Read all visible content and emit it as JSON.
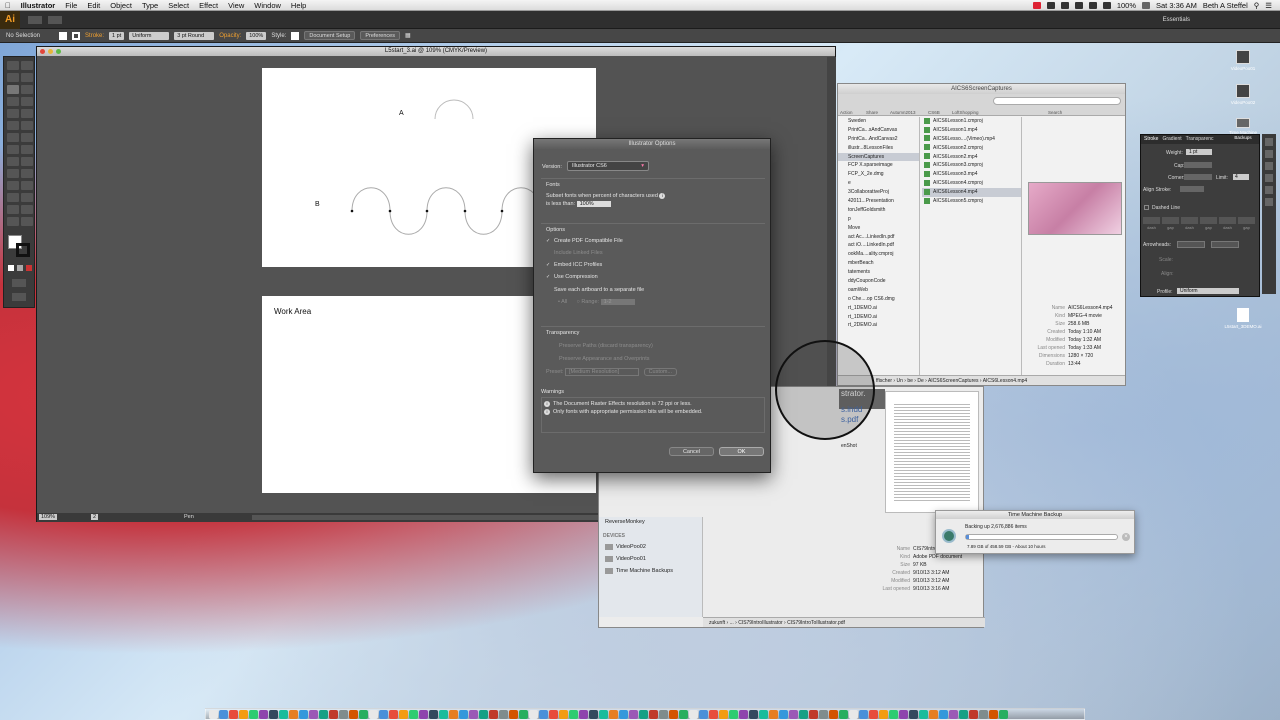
{
  "menubar": {
    "app": "Illustrator",
    "items": [
      "File",
      "Edit",
      "Object",
      "Type",
      "Select",
      "Effect",
      "View",
      "Window",
      "Help"
    ],
    "battery": "100%",
    "clock": "Sat 3:36 AM",
    "user": "Beth A Steffel"
  },
  "topbar": {
    "logo": "Ai",
    "workspace": "Essentials"
  },
  "control": {
    "selection": "No Selection",
    "stroke_label": "Stroke:",
    "stroke_value": "1 pt",
    "profile": "Uniform",
    "brush": "3 pt Round",
    "opacity_label": "Opacity:",
    "opacity_value": "100%",
    "style_label": "Style:",
    "doc_setup": "Document Setup",
    "preferences": "Preferences"
  },
  "document": {
    "title": "L5start_3.ai @ 109% (CMYK/Preview)",
    "label_a": "A",
    "label_b": "B",
    "work_area": "Work Area",
    "zoom": "109%",
    "page": "2",
    "tool_status": "Pen"
  },
  "dialog": {
    "title": "Illustrator Options",
    "version_label": "Version:",
    "version_value": "Illustrator CS6",
    "fonts_header": "Fonts",
    "subset_text_1": "Subset fonts when percent of characters used",
    "subset_text_2": "is less than:",
    "subset_value": "100%",
    "options_header": "Options",
    "opt_pdf": "Create PDF Compatible File",
    "opt_linked": "Include Linked Files",
    "opt_icc": "Embed ICC Profiles",
    "opt_compress": "Use Compression",
    "opt_artboards": "Save each artboard to a separate file",
    "opt_all": "All",
    "opt_range": "Range:",
    "opt_range_value": "1-2",
    "transparency_header": "Transparency",
    "tr_paths": "Preserve Paths (discard transparency)",
    "tr_appearance": "Preserve Appearance and Overprints",
    "preset_label": "Preset:",
    "preset_value": "[Medium Resolution]",
    "custom_label": "Custom...",
    "warnings_header": "Warnings",
    "warn_1": "The Document Raster Effects resolution is 72 ppi or less.",
    "warn_2": "Only fonts with appropriate permission bits will be embedded.",
    "cancel": "Cancel",
    "ok": "OK"
  },
  "finder1": {
    "title": "AICS6ScreenCaptures",
    "toolbar": [
      "Action",
      "Share",
      "Autumn2013",
      "CS6B",
      "LoftShopping"
    ],
    "search": "Search",
    "left_items": [
      "Sweden",
      "PrintCa...sAndCanvas",
      "PrintCa...AndCanvas2",
      "illustr...8LessonFiles",
      "ScreenCaptures",
      "FCP X.sparseimage",
      "FCP_X_2e.dmg",
      "e",
      "3CollaborativeProj",
      "42011...Presentation",
      "tonJeffGoldsmith",
      "p",
      "Move",
      "act Ac....LinkedIn.pdf",
      "act iO....LinkedIn.pdf",
      "ookMa....ality.cmproj",
      "mberBeach",
      "tatements",
      "ddyCouponCode",
      "oamWeb",
      "o Che....op CS6.dmg",
      "rt_1DEMO.ai",
      "rt_1DEMO.ai",
      "rt_2DEMO.ai"
    ],
    "files": [
      "AICS6Lesson1.cmproj",
      "AICS6Lesson1.mp4",
      "AICS6Lesso....(Vimeo).mp4",
      "AICS6Lesson2.cmproj",
      "AICS6Lesson2.mp4",
      "AICS6Lesson3.cmproj",
      "AICS6Lesson3.mp4",
      "AICS6Lesson4.cmproj",
      "AICS6Lesson4.mp4",
      "AICS6Lesson5.cmproj"
    ],
    "info": [
      {
        "k": "Name",
        "v": "AICS6Lesson4.mp4"
      },
      {
        "k": "Kind",
        "v": "MPEG-4 movie"
      },
      {
        "k": "Size",
        "v": "258.6 MB"
      },
      {
        "k": "Created",
        "v": "Today 1:10 AM"
      },
      {
        "k": "Modified",
        "v": "Today 1:32 AM"
      },
      {
        "k": "Last opened",
        "v": "Today 1:33 AM"
      },
      {
        "k": "Dimensions",
        "v": "1280 × 720"
      },
      {
        "k": "Duration",
        "v": "13:44"
      }
    ],
    "path": [
      "Un",
      "be",
      "De",
      "AICS6ScreenCaptures",
      "AICS6Lesson4.mp4"
    ],
    "path_left": "ffischer"
  },
  "finder2": {
    "partial": [
      "strator.",
      "s.indd",
      "s.pdf",
      "enShot"
    ],
    "sidebar_mid": "ReverseMonkey",
    "devices_header": "DEVICES",
    "devices": [
      "VideoPoo02",
      "VideoPoo01",
      "Time Machine Backups"
    ],
    "info": [
      {
        "k": "Name",
        "v": "CIS79IntroToIllustrator.pdf"
      },
      {
        "k": "Kind",
        "v": "Adobe PDF document"
      },
      {
        "k": "Size",
        "v": "97 KB"
      },
      {
        "k": "Created",
        "v": "9/10/13 3:12 AM"
      },
      {
        "k": "Modified",
        "v": "9/10/13 3:12 AM"
      },
      {
        "k": "Last opened",
        "v": "9/10/13 3:16 AM"
      }
    ],
    "path": [
      "zukunft",
      "CIS79IntroIllustrator",
      "CIS79IntroToIllustrator.pdf"
    ]
  },
  "timemachine": {
    "title": "Time Machine Backup",
    "status": "Backing up 2,676,886 items",
    "detail": "7.89 GB of 458.59 GB - About 10 hours",
    "progress": 0.02
  },
  "stroke_panel": {
    "tabs": [
      "Stroke",
      "Gradient",
      "Transparenc"
    ],
    "weight_label": "Weight:",
    "weight_value": "1 pt",
    "cap": "Cap:",
    "corner": "Corner:",
    "limit": "Limit:",
    "limit_value": "4",
    "align": "Align Stroke:",
    "dashed": "Dashed Line",
    "dash_labels": [
      "dash",
      "gap",
      "dash",
      "gap",
      "dash",
      "gap"
    ],
    "arrowheads": "Arrowheads:",
    "scale": "Scale:",
    "align2": "Align:",
    "profile_label": "Profile:",
    "profile_value": "Uniform"
  },
  "desktop_icons": [
    {
      "label": "VideoPoo01"
    },
    {
      "label": "VideoPoo02"
    },
    {
      "label": "Time Machine Backups"
    },
    {
      "label": "L5start_3DEMO.ai"
    }
  ]
}
